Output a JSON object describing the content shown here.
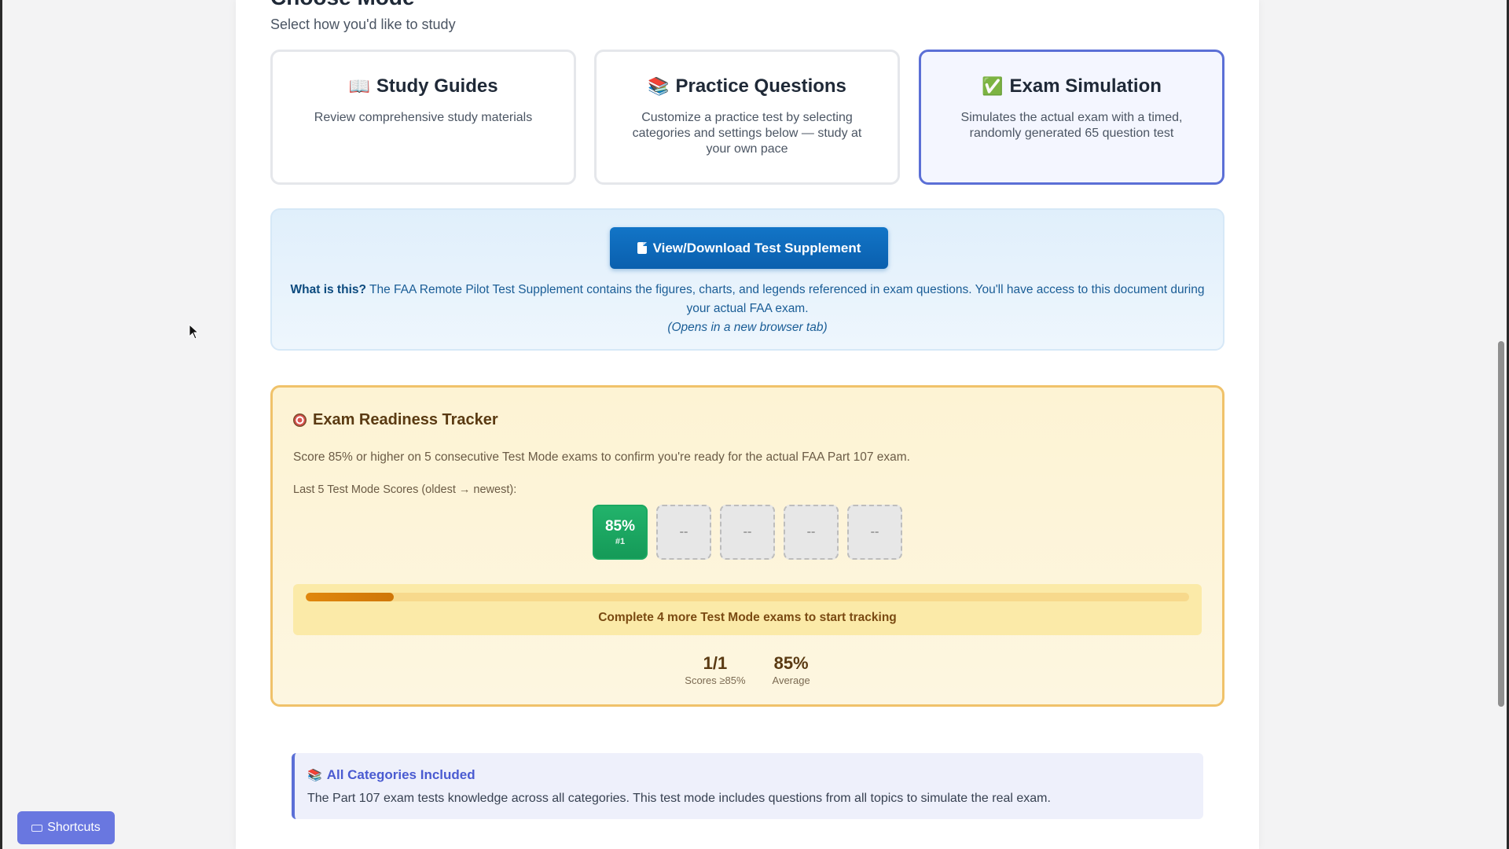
{
  "section": {
    "title": "Choose Mode",
    "subtitle": "Select how you'd like to study"
  },
  "modes": [
    {
      "icon": "open-book-icon",
      "glyph": "📖",
      "title": "Study Guides",
      "description": "Review comprehensive study materials",
      "selected": false
    },
    {
      "icon": "books-icon",
      "glyph": "📚",
      "title": "Practice Questions",
      "description": "Customize a practice test by selecting categories and settings below — study at your own pace",
      "selected": false
    },
    {
      "icon": "check-mark-icon",
      "glyph": "✅",
      "title": "Exam Simulation",
      "description": "Simulates the actual exam with a timed, randomly generated 65 question test",
      "selected": true
    }
  ],
  "supplement": {
    "button_label": "View/Download Test Supplement",
    "what_is_this": "What is this?",
    "description": "The FAA Remote Pilot Test Supplement contains the figures, charts, and legends referenced in exam questions. You'll have access to this document during your actual FAA exam.",
    "note": "(Opens in a new browser tab)"
  },
  "tracker": {
    "title": "Exam Readiness Tracker",
    "description": "Score 85% or higher on 5 consecutive Test Mode exams to confirm you're ready for the actual FAA Part 107 exam.",
    "scores_label": "Last 5 Test Mode Scores (oldest → newest):",
    "scores": [
      {
        "value": "85%",
        "index": "#1",
        "filled": true
      },
      {
        "value": "--",
        "index": "",
        "filled": false
      },
      {
        "value": "--",
        "index": "",
        "filled": false
      },
      {
        "value": "--",
        "index": "",
        "filled": false
      },
      {
        "value": "--",
        "index": "",
        "filled": false
      }
    ],
    "progress_fraction": 0.1,
    "progress_text": "Complete 4 more Test Mode exams to start tracking",
    "stats": [
      {
        "value": "1/1",
        "label": "Scores ≥85%"
      },
      {
        "value": "85%",
        "label": "Average"
      }
    ]
  },
  "categories": {
    "title": "All Categories Included",
    "description": "The Part 107 exam tests knowledge across all categories. This test mode includes questions from all topics to simulate the real exam."
  },
  "shortcuts": {
    "label": "Shortcuts"
  },
  "colors": {
    "accent": "#5b6fd6",
    "primary_button": "#0a5fae",
    "success": "#1aa861",
    "tracker_border": "#f0c26a",
    "progress": "#e0870d"
  }
}
